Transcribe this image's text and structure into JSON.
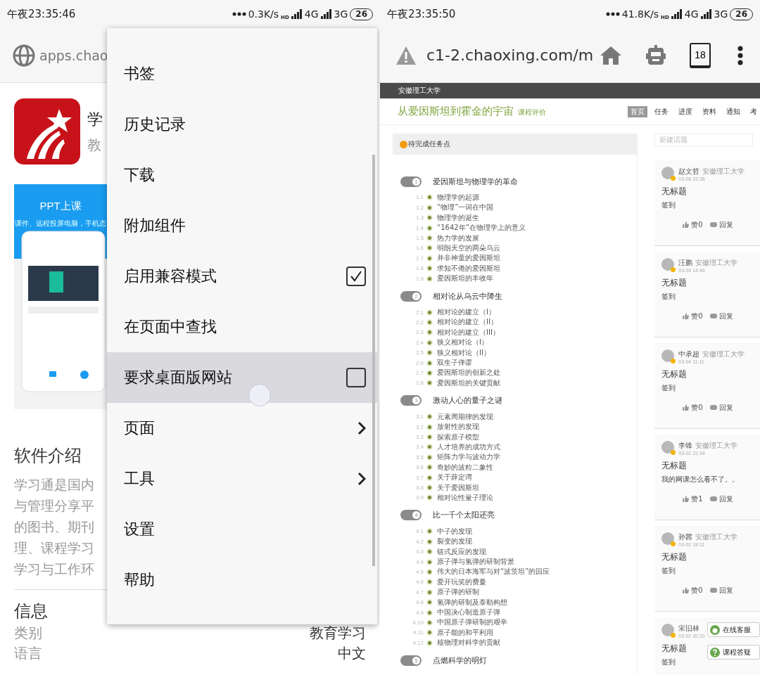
{
  "left_screen": {
    "status_bar": {
      "time": "午夜23:35:46",
      "speed": "0.3K/s",
      "hd": "HD",
      "network_1": "4G",
      "network_2": "3G",
      "battery": "26"
    },
    "address_bar": {
      "url": "apps.chao"
    },
    "app": {
      "name": "学",
      "category": "教"
    },
    "promo": {
      "title": "PPT上课",
      "subtitle": "课件、远程投屏电脑，手机态"
    },
    "intro": {
      "heading": "软件介绍",
      "lines": [
        "学习通是国内",
        "与管理分享平",
        "的图书、期刊",
        "理、课程学习",
        "学习与工作环"
      ]
    },
    "info": {
      "heading": "信息",
      "rows": [
        {
          "label": "类别",
          "value": "教育学习"
        },
        {
          "label": "语言",
          "value": "中文"
        }
      ]
    },
    "menu": {
      "items": [
        {
          "label": "书签",
          "kind": "plain",
          "pressed": false
        },
        {
          "label": "历史记录",
          "kind": "plain",
          "pressed": false
        },
        {
          "label": "下载",
          "kind": "plain",
          "pressed": false
        },
        {
          "label": "附加组件",
          "kind": "plain",
          "pressed": false
        },
        {
          "label": "启用兼容模式",
          "kind": "checkbox",
          "checked": true,
          "pressed": false
        },
        {
          "label": "在页面中查找",
          "kind": "plain",
          "pressed": false
        },
        {
          "label": "要求桌面版网站",
          "kind": "checkbox",
          "checked": false,
          "pressed": true
        },
        {
          "label": "页面",
          "kind": "submenu",
          "pressed": false
        },
        {
          "label": "工具",
          "kind": "submenu",
          "pressed": false
        },
        {
          "label": "设置",
          "kind": "plain",
          "pressed": false
        },
        {
          "label": "帮助",
          "kind": "plain",
          "pressed": false
        }
      ]
    }
  },
  "right_screen": {
    "status_bar": {
      "time": "午夜23:35:50",
      "speed": "41.8K/s",
      "hd": "HD",
      "network_1": "4G",
      "network_2": "3G",
      "battery": "26"
    },
    "address_bar": {
      "url": "c1-2.chaoxing.com/m",
      "tab_count": "18"
    },
    "school_bar": {
      "name": "安徽理工大学"
    },
    "course": {
      "title": "从爱因斯坦到霍金的宇宙",
      "tag": "课程评价"
    },
    "course_nav": [
      {
        "label": "首页",
        "selected": true
      },
      {
        "label": "任务",
        "selected": false
      },
      {
        "label": "进度",
        "selected": false
      },
      {
        "label": "资料",
        "selected": false
      },
      {
        "label": "通知",
        "selected": false
      },
      {
        "label": "考",
        "selected": false
      }
    ],
    "tasks": {
      "heading": "待完成任务点",
      "chapters": [
        {
          "number": "1",
          "title": "爱因斯坦与物理学的革命",
          "sections": [
            {
              "number": "1.1",
              "title": "物理学的起源"
            },
            {
              "number": "1.2",
              "title": "“物理”一词在中国"
            },
            {
              "number": "1.3",
              "title": "物理学的诞生"
            },
            {
              "number": "1.4",
              "title": "“1642年”在物理学上的意义"
            },
            {
              "number": "1.5",
              "title": "热力学的发展"
            },
            {
              "number": "1.6",
              "title": "明朗天空的两朵乌云"
            },
            {
              "number": "1.7",
              "title": "并非神童的爱因斯坦"
            },
            {
              "number": "1.8",
              "title": "求知不倦的爱因斯坦"
            },
            {
              "number": "1.9",
              "title": "爱因斯坦的丰收年"
            }
          ]
        },
        {
          "number": "2",
          "title": "相对论从乌云中降生",
          "sections": [
            {
              "number": "2.1",
              "title": "相对论的建立（I）"
            },
            {
              "number": "2.2",
              "title": "相对论的建立（II）"
            },
            {
              "number": "2.3",
              "title": "相对论的建立（III）"
            },
            {
              "number": "2.4",
              "title": "狭义相对论（I）"
            },
            {
              "number": "2.5",
              "title": "狭义相对论（II）"
            },
            {
              "number": "2.6",
              "title": "双生子佯谬"
            },
            {
              "number": "2.7",
              "title": "爱因斯坦的创新之处"
            },
            {
              "number": "2.8",
              "title": "爱因斯坦的关键贡献"
            }
          ]
        },
        {
          "number": "3",
          "title": "激动人心的量子之谜",
          "sections": [
            {
              "number": "3.1",
              "title": "元素周期律的发现"
            },
            {
              "number": "3.2",
              "title": "放射性的发现"
            },
            {
              "number": "3.3",
              "title": "探索原子模型"
            },
            {
              "number": "3.4",
              "title": "人才培养的成功方式"
            },
            {
              "number": "3.5",
              "title": "矩阵力学与波动力学"
            },
            {
              "number": "3.6",
              "title": "奇妙的波粒二象性"
            },
            {
              "number": "3.7",
              "title": "关于薛定谔"
            },
            {
              "number": "3.8",
              "title": "关于爱因斯坦"
            },
            {
              "number": "3.9",
              "title": "相对论性量子理论"
            }
          ]
        },
        {
          "number": "4",
          "title": "比一千个太阳还亮",
          "sections": [
            {
              "number": "4.1",
              "title": "中子的发现"
            },
            {
              "number": "4.2",
              "title": "裂变的发现"
            },
            {
              "number": "4.3",
              "title": "链式反应的发现"
            },
            {
              "number": "4.4",
              "title": "原子弹与氢弹的研制背景"
            },
            {
              "number": "4.5",
              "title": "伟大的日本海军与对“波茨坦”的回应"
            },
            {
              "number": "4.6",
              "title": "爱开玩笑的费曼"
            },
            {
              "number": "4.7",
              "title": "原子弹的研制"
            },
            {
              "number": "4.8",
              "title": "氢弹的研制及泰勒构想"
            },
            {
              "number": "4.9",
              "title": "中国决心制造原子弹"
            },
            {
              "number": "4.10",
              "title": "中国原子弹研制的艰辛"
            },
            {
              "number": "4.11",
              "title": "原子能的和平利用"
            },
            {
              "number": "4.12",
              "title": "核物理对科学的贡献"
            }
          ]
        },
        {
          "number": "5",
          "title": "点燃科学的明灯"
        }
      ]
    },
    "discussion": {
      "search_placeholder": "新建话题",
      "posts": [
        {
          "author": "赵文哲",
          "school": "安徽理工大学",
          "time": "03-06 23:36",
          "title": "无标题",
          "body": "签到",
          "likes": "赞0",
          "reply": "回复"
        },
        {
          "author": "汪鹏",
          "school": "安徽理工大学",
          "time": "03-04 14:46",
          "title": "无标题",
          "body": "签到",
          "likes": "赞0",
          "reply": "回复"
        },
        {
          "author": "中承超",
          "school": "安徽理工大学",
          "time": "03-04 11:11",
          "title": "无标题",
          "body": "签到",
          "likes": "赞0",
          "reply": "回复"
        },
        {
          "author": "李锋",
          "school": "安徽理工大学",
          "time": "03-02 22:34",
          "title": "无标题",
          "body": "我的网课怎么看不了。。",
          "likes": "赞1",
          "reply": "回复"
        },
        {
          "author": "孙茜",
          "school": "安徽理工大学",
          "time": "03-02 18:11",
          "title": "无标题",
          "body": "签到",
          "likes": "赞0",
          "reply": "回复"
        },
        {
          "author": "宋旧林",
          "time": "03-02 20:20",
          "title": "无标题",
          "body": "签到"
        }
      ]
    },
    "floating_buttons": [
      {
        "label": "在线客服",
        "kind": "service"
      },
      {
        "label": "课程答疑",
        "kind": "question"
      }
    ]
  }
}
